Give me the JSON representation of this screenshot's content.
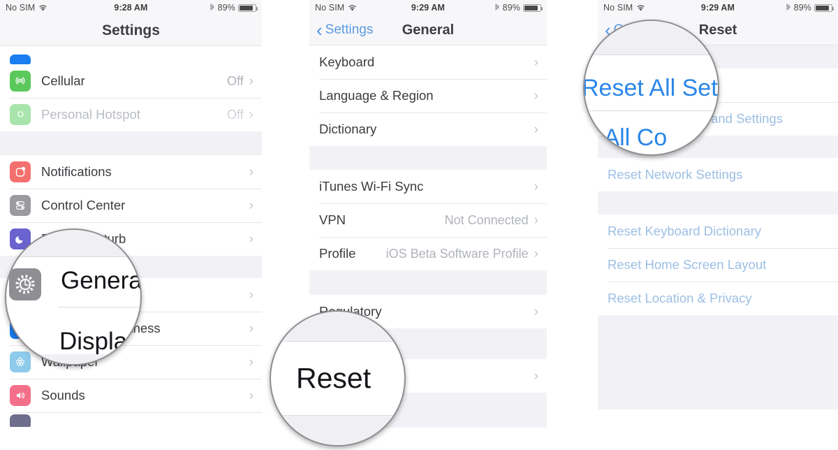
{
  "panels": [
    {
      "id": "settings",
      "status": {
        "carrier": "No SIM",
        "wifi_icon": "wifi-icon",
        "time": "9:28 AM",
        "bluetooth_icon": "bluetooth-icon",
        "battery": "89%",
        "battery_icon": "battery-icon"
      },
      "nav": {
        "title": "Settings"
      },
      "rows": [
        {
          "label": "Cellular",
          "value": "Off",
          "icon": "cellular-icon",
          "icon_color": "#5ac85a",
          "chevron": "›"
        },
        {
          "label": "Personal Hotspot",
          "value": "Off",
          "icon": "hotspot-icon",
          "icon_color": "#a8e3a8",
          "chevron": "›",
          "muted": true
        },
        {
          "label": "Notifications",
          "value": "",
          "icon": "notifications-icon",
          "icon_color": "#f4706e",
          "chevron": "›"
        },
        {
          "label": "Control Center",
          "value": "",
          "icon": "control-center-icon",
          "icon_color": "#9a9a9f",
          "chevron": "›"
        },
        {
          "label": "Do Not Disturb",
          "value": "",
          "icon": "do-not-disturb-icon",
          "icon_color": "#6b63cf",
          "chevron": "›"
        },
        {
          "label": "General",
          "value": "",
          "icon": "general-gear-icon",
          "icon_color": "#8e8e93",
          "chevron": "›"
        },
        {
          "label": "Display & Brightness",
          "value": "",
          "icon": "display-brightness-icon",
          "icon_color": "#1a7df0",
          "chevron": "›"
        },
        {
          "label": "Wallpaper",
          "value": "",
          "icon": "wallpaper-icon",
          "icon_color": "#8ecaea",
          "chevron": "›"
        },
        {
          "label": "Sounds",
          "value": "",
          "icon": "sounds-icon",
          "icon_color": "#f4708a",
          "chevron": "›"
        }
      ],
      "lens": {
        "gear_icon": "general-gear-icon",
        "line1": "General",
        "line2": "Displa"
      }
    },
    {
      "id": "general",
      "status": {
        "carrier": "No SIM",
        "wifi_icon": "wifi-icon",
        "time": "9:29 AM",
        "bluetooth_icon": "bluetooth-icon",
        "battery": "89%",
        "battery_icon": "battery-icon"
      },
      "nav": {
        "back": "Settings",
        "title": "General",
        "back_chevron": "‹"
      },
      "group_a": [
        {
          "label": "Keyboard",
          "value": "",
          "chevron": "›"
        },
        {
          "label": "Language & Region",
          "value": "",
          "chevron": "›"
        },
        {
          "label": "Dictionary",
          "value": "",
          "chevron": "›"
        }
      ],
      "group_b": [
        {
          "label": "iTunes Wi-Fi Sync",
          "value": "",
          "chevron": "›"
        },
        {
          "label": "VPN",
          "value": "Not Connected",
          "chevron": "›"
        },
        {
          "label": "Profile",
          "value": "iOS Beta Software Profile",
          "chevron": "›"
        }
      ],
      "group_c": [
        {
          "label": "Regulatory",
          "value": "",
          "chevron": "›"
        }
      ],
      "group_d": [
        {
          "label": "Reset",
          "value": "",
          "chevron": "›"
        }
      ],
      "lens": {
        "line1": "Reset"
      }
    },
    {
      "id": "reset",
      "status": {
        "carrier": "No SIM",
        "wifi_icon": "wifi-icon",
        "time": "9:29 AM",
        "bluetooth_icon": "bluetooth-icon",
        "battery": "89%",
        "battery_icon": "battery-icon"
      },
      "nav": {
        "back": "General",
        "title": "Reset",
        "back_chevron": "‹"
      },
      "group_a": [
        {
          "label": "Reset All Settings"
        },
        {
          "label": "Erase All Content and Settings"
        }
      ],
      "group_b": [
        {
          "label": "Reset Network Settings"
        }
      ],
      "group_c": [
        {
          "label": "Reset Keyboard Dictionary"
        },
        {
          "label": "Reset Home Screen Layout"
        },
        {
          "label": "Reset Location & Privacy"
        }
      ],
      "lens": {
        "line1": "Reset All Settin",
        "line2": "se All Co"
      }
    }
  ],
  "colors": {
    "ios_blue": "#3d90e8",
    "list_background": "#f2f2f6",
    "separator": "#e6e6e9",
    "label": "#3c3c41"
  }
}
